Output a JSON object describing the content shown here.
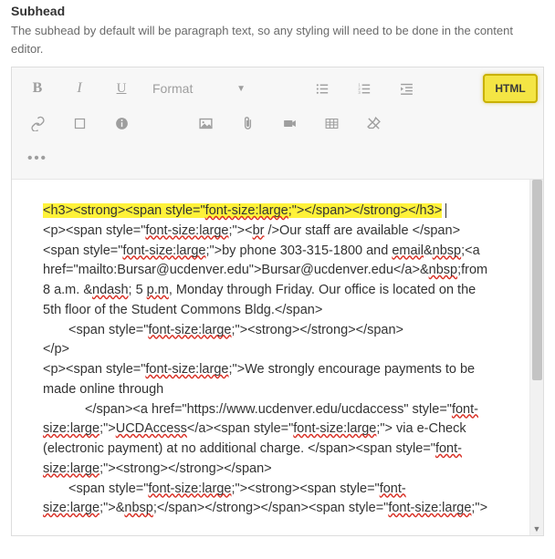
{
  "field": {
    "label": "Subhead",
    "help": "The subhead by default will be paragraph text, so any styling will need to be done in the content editor."
  },
  "toolbar": {
    "format_label": "Format",
    "html_label": "HTML"
  },
  "source": {
    "line1_pre": "<h3><strong><span style=\"",
    "line1_err": "font-size:large",
    "line1_post": ";\"></span></strong></h3>",
    "line2_pre": "<p><span style=\"",
    "line2_err": "font-size:large",
    "line2_mid": ";\"><",
    "line2_err2": "br",
    "line2_post": " />Our staff are available </span>",
    "line3_pre": "<span style=\"",
    "line3_err": "font-size:large",
    "line3_mid": ";\">by phone 303-315-1800 and ",
    "line3_err2": "email",
    "line3_amp": "&",
    "line3_err3": "nbsp",
    "line3_post": ";<a",
    "line4_pre": "href=\"mailto:Bursar@ucdenver.edu\">Bursar@ucdenver.edu</a>&",
    "line4_err": "nbsp",
    "line4_post": ";from",
    "line5_pre": "8 a.m. &",
    "line5_err": "ndash",
    "line5_mid": "; 5 ",
    "line5_err2": "p.m",
    "line5_post": ", Monday through Friday. Our office is located on the",
    "line6": "5th floor of the Student Commons Bldg.</span>",
    "line7_pre": "<span style=\"",
    "line7_err": "font-size:large",
    "line7_post": ";\"><strong></strong></span>",
    "line8": "</p>",
    "line9_pre": "<p><span style=\"",
    "line9_err": "font-size:large",
    "line9_post": ";\">We strongly encourage payments to be",
    "line10": "made online through",
    "line11_pre": "</span><a href=\"https://www.ucdenver.edu/ucdaccess\" style=\"",
    "line11_err": "font-",
    "line12_err": "size:large",
    "line12_mid": ";\">",
    "line12_err2": "UCDAccess",
    "line12_mid2": "</a><span style=\"",
    "line12_err3": "font-size:large",
    "line12_post": ";\"> via e-Check",
    "line13_pre": "(electronic payment) at no additional charge. </span><span style=\"",
    "line13_err": "font-",
    "line14_err": "size:large",
    "line14_post": ";\"><strong></strong></span>",
    "line15_pre": "<span style=\"",
    "line15_err": "font-size:large",
    "line15_mid": ";\"><strong><span style=\"",
    "line15_err2": "font-",
    "line16_err": "size:large",
    "line16_mid": ";\">&",
    "line16_err2": "nbsp",
    "line16_mid2": ";</span></strong></span><span style=\"",
    "line16_err3": "font-size:large",
    "line16_post": ";\">"
  }
}
